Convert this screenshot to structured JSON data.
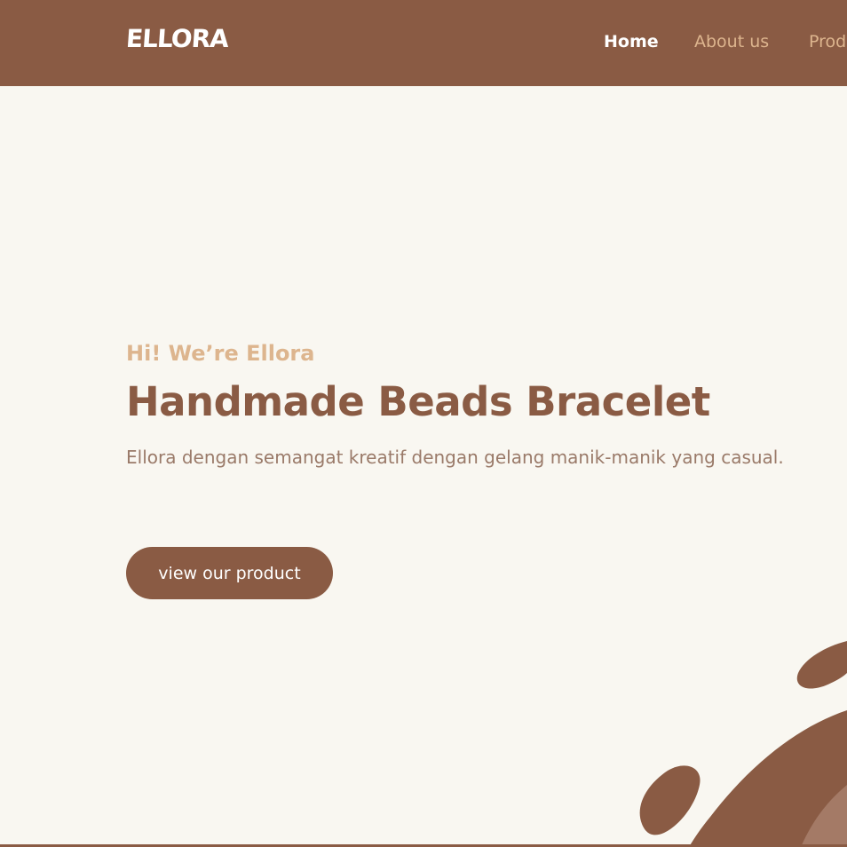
{
  "brand": {
    "logo_text": "ELLORA"
  },
  "nav": {
    "items": [
      {
        "label": "Home",
        "active": true
      },
      {
        "label": "About us",
        "active": false
      },
      {
        "label": "Prod",
        "active": false
      }
    ]
  },
  "hero": {
    "eyebrow": "Hi! We’re Ellora",
    "title": "Handmade Beads Bracelet",
    "description": "Ellora dengan semangat kreatif dengan gelang manik-manik yang casual.",
    "cta_label": "view our product"
  },
  "colors": {
    "primary_brown": "#8A5B44",
    "accent_tan": "#DDB58E",
    "background_cream": "#F9F7F1",
    "text_muted": "#9A7A69",
    "active_nav": "#FFFFFF"
  },
  "icons": {
    "decorative": [
      "blob-shape",
      "leaf-shape"
    ]
  }
}
